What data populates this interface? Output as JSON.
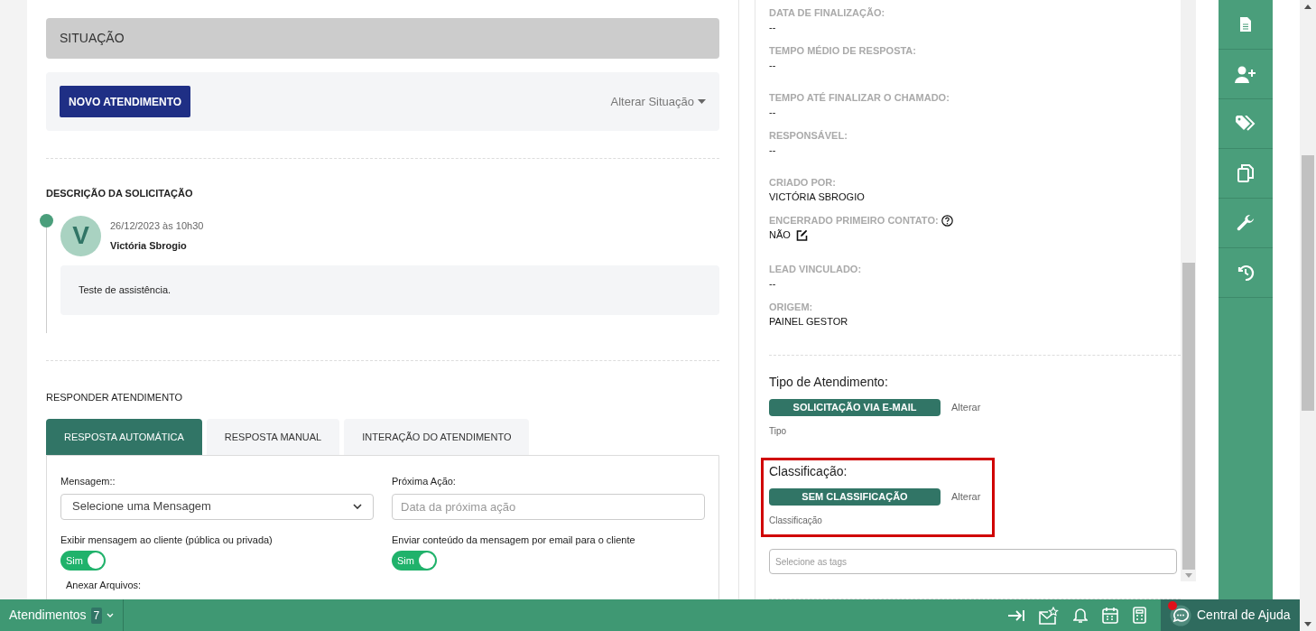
{
  "situation": {
    "title": "SITUAÇÃO"
  },
  "actions": {
    "new_button": "NOVO ATENDIMENTO",
    "change_status": "Alterar Situação"
  },
  "description": {
    "title": "DESCRIÇÃO DA SOLICITAÇÃO",
    "entries": [
      {
        "avatar": "V",
        "date": "26/12/2023 às 10h30",
        "author": "Victória Sbrogio",
        "message": "Teste de assistência."
      }
    ]
  },
  "reply": {
    "title": "RESPONDER ATENDIMENTO",
    "tabs": [
      {
        "label": "RESPOSTA AUTOMÁTICA",
        "selected": true
      },
      {
        "label": "RESPOSTA MANUAL",
        "selected": false
      },
      {
        "label": "INTERAÇÃO DO ATENDIMENTO",
        "selected": false
      }
    ],
    "message_label": "Mensagem::",
    "message_select": "Selecione uma Mensagem",
    "next_action_label": "Próxima Ação:",
    "next_action_placeholder": "Data da próxima ação",
    "toggles": [
      {
        "label": "Exibir mensagem ao cliente (pública ou privada)",
        "text": "Sim",
        "on": true
      },
      {
        "label": "Enviar conteúdo da mensagem por email para o cliente",
        "text": "Sim",
        "on": true
      }
    ],
    "attach_label": "Anexar Arquivos:"
  },
  "details": [
    {
      "label": "DATA DE FINALIZAÇÃO:",
      "value": "--"
    },
    {
      "label": "TEMPO MÉDIO DE RESPOSTA:",
      "value": "--"
    },
    {
      "label": "TEMPO ATÉ FINALIZAR O CHAMADO:",
      "value": "--"
    },
    {
      "label": "RESPONSÁVEL:",
      "value": "--"
    },
    {
      "label": "CRIADO POR:",
      "value": "VICTÓRIA SBROGIO"
    },
    {
      "label": "ENCERRADO PRIMEIRO CONTATO:",
      "value": "NÃO",
      "help": true,
      "editable": true
    },
    {
      "label": "LEAD VINCULADO:",
      "value": "--"
    },
    {
      "label": "ORIGEM:",
      "value": "PAINEL GESTOR"
    }
  ],
  "type_section": {
    "title": "Tipo de Atendimento:",
    "badge": "SOLICITAÇÃO VIA E-MAIL",
    "link": "Alterar",
    "caption": "Tipo",
    "highlighted": false
  },
  "classification_section": {
    "title": "Classificação:",
    "badge": "SEM CLASSIFICAÇÃO",
    "link": "Alterar",
    "caption": "Classificação",
    "highlighted": true
  },
  "tags": {
    "placeholder": "Selecione as tags"
  },
  "bottom_bar": {
    "label": "Atendimentos",
    "count": "7",
    "help": "Central de Ajuda",
    "help_notification": true
  }
}
